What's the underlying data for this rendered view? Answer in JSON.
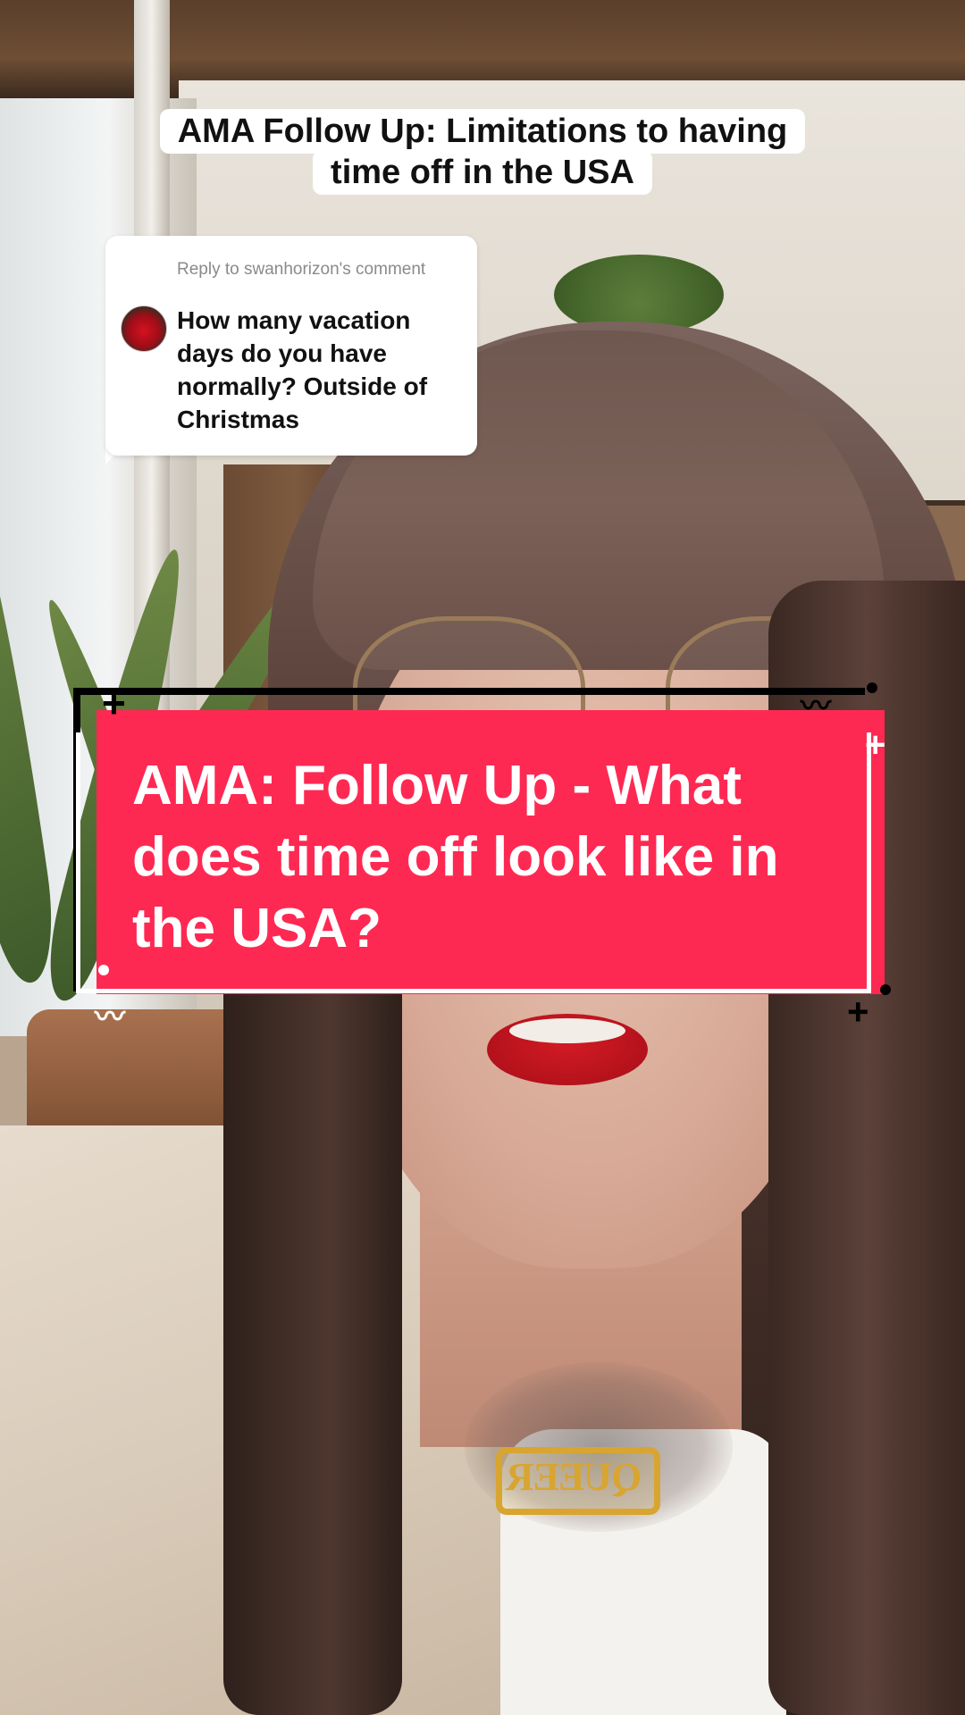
{
  "video_title": {
    "line1": "AMA Follow Up: Limitations to having",
    "line2": "time off in the USA"
  },
  "reply_card": {
    "header": "Reply to swanhorizon's comment",
    "comment": "How many vacation days do you have normally? Outside of Christmas"
  },
  "banner": {
    "text": "AMA: Follow Up - What does time off look like in the USA?"
  },
  "necklace_text": "QUEER",
  "colors": {
    "banner_pink": "#fe2952",
    "title_bg": "#ffffff",
    "text_dark": "#111111"
  }
}
